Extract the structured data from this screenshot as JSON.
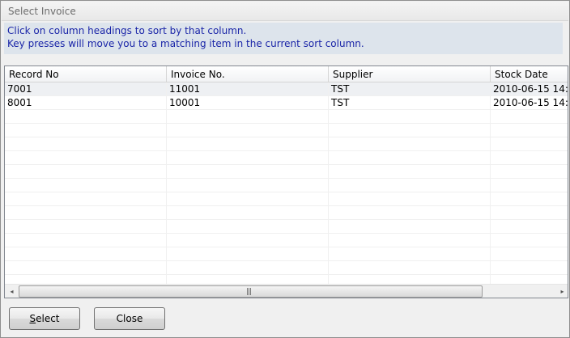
{
  "window": {
    "title": "Select Invoice"
  },
  "info": {
    "line1": "Click on column headings to sort by that column.",
    "line2": "Key presses will move you to a matching item in the current sort column."
  },
  "table": {
    "columns": [
      "Record No",
      "Invoice No.",
      "Supplier",
      "Stock Date"
    ],
    "rows": [
      [
        "7001",
        "11001",
        "TST",
        "2010-06-15 14:"
      ],
      [
        "8001",
        "10001",
        "TST",
        "2010-06-15 14:"
      ]
    ]
  },
  "scrollbar": {
    "left_arrow": "◂",
    "right_arrow": "▸",
    "grip": "|||"
  },
  "buttons": {
    "select_mnemonic": "S",
    "select_rest": "elect",
    "close": "Close"
  }
}
